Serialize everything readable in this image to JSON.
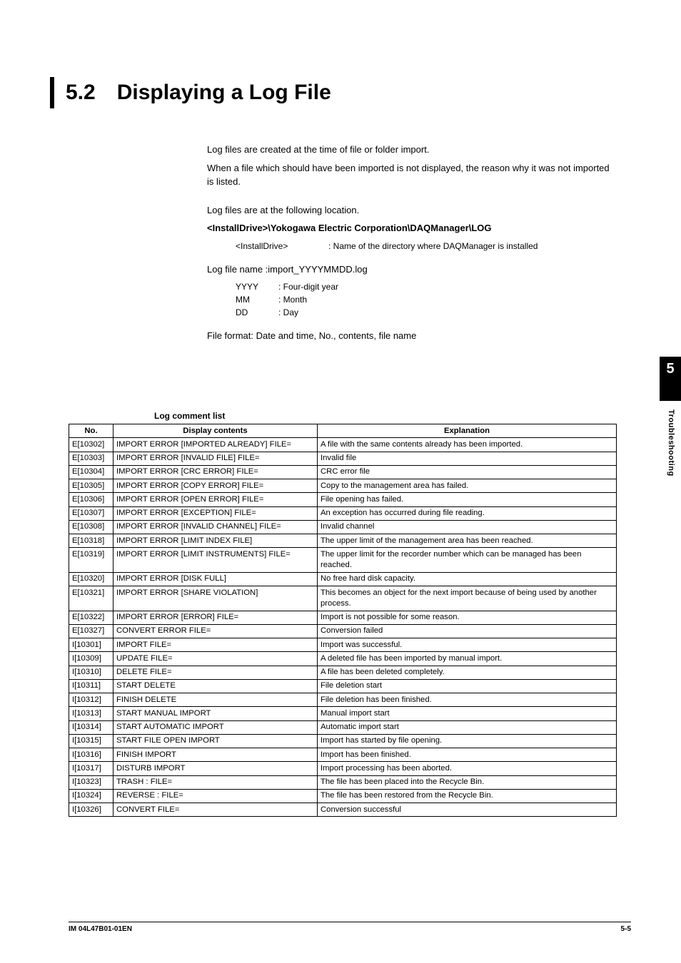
{
  "heading": {
    "number": "5.2",
    "title": "Displaying a Log File"
  },
  "intro": {
    "p1": "Log files are created at the time of file or folder import.",
    "p2": "When a file which should have been imported is not displayed, the reason why it was not imported is listed.",
    "p3": "Log files are at the following location.",
    "path": "<InstallDrive>\\Yokogawa Electric Corporation\\DAQManager\\LOG",
    "install_kv": {
      "k": "<InstallDrive>",
      "v": ": Name of the directory where DAQManager is installed"
    },
    "p4": "Log file name :import_YYYYMMDD.log",
    "kv1": {
      "k": "YYYY",
      "v": ": Four-digit year"
    },
    "kv2": {
      "k": "MM",
      "v": ": Month"
    },
    "kv3": {
      "k": "DD",
      "v": ": Day"
    },
    "p5": "File format: Date and time, No., contents, file name"
  },
  "table": {
    "caption": "Log comment list",
    "headers": {
      "no": "No.",
      "disp": "Display contents",
      "expl": "Explanation"
    },
    "rows": [
      {
        "no": "E[10302]",
        "disp": "IMPORT ERROR [IMPORTED ALREADY] FILE=",
        "expl": "A file with the same contents already has been imported."
      },
      {
        "no": "E[10303]",
        "disp": "IMPORT ERROR [INVALID FILE] FILE=",
        "expl": "Invalid file"
      },
      {
        "no": "E[10304]",
        "disp": "IMPORT ERROR [CRC ERROR] FILE=",
        "expl": "CRC error file"
      },
      {
        "no": "E[10305]",
        "disp": "IMPORT ERROR [COPY ERROR] FILE=",
        "expl": "Copy to the management area has failed."
      },
      {
        "no": "E[10306]",
        "disp": "IMPORT ERROR [OPEN ERROR] FILE=",
        "expl": "File opening has failed."
      },
      {
        "no": "E[10307]",
        "disp": "IMPORT ERROR [EXCEPTION] FILE=",
        "expl": "An exception has occurred during file reading."
      },
      {
        "no": "E[10308]",
        "disp": "IMPORT ERROR [INVALID CHANNEL] FILE=",
        "expl": "Invalid channel"
      },
      {
        "no": "E[10318]",
        "disp": "IMPORT ERROR [LIMIT INDEX FILE]",
        "expl": "The upper limit of the management area has been reached."
      },
      {
        "no": "E[10319]",
        "disp": "IMPORT ERROR [LIMIT INSTRUMENTS] FILE=",
        "expl": "The upper limit for the recorder number which can be managed has been reached."
      },
      {
        "no": "E[10320]",
        "disp": "IMPORT ERROR [DISK FULL]",
        "expl": "No free hard disk capacity."
      },
      {
        "no": "E[10321]",
        "disp": "IMPORT ERROR [SHARE VIOLATION]",
        "expl": "This becomes an object for the next import because of being used by another process."
      },
      {
        "no": "E[10322]",
        "disp": "IMPORT ERROR [ERROR] FILE=",
        "expl": "Import is not possible for some reason."
      },
      {
        "no": "E[10327]",
        "disp": "CONVERT ERROR FILE=",
        "expl": "Conversion failed"
      },
      {
        "no": "I[10301]",
        "disp": "IMPORT FILE=",
        "expl": "Import was successful."
      },
      {
        "no": "I[10309]",
        "disp": "UPDATE FILE=",
        "expl": "A deleted file has been imported by manual import."
      },
      {
        "no": "I[10310]",
        "disp": "DELETE FILE=",
        "expl": "A file has been deleted completely."
      },
      {
        "no": "I[10311]",
        "disp": "START DELETE",
        "expl": "File deletion start"
      },
      {
        "no": "I[10312]",
        "disp": "FINISH DELETE",
        "expl": "File deletion has been finished."
      },
      {
        "no": "I[10313]",
        "disp": "START MANUAL IMPORT",
        "expl": "Manual import start"
      },
      {
        "no": "I[10314]",
        "disp": "START AUTOMATIC IMPORT",
        "expl": "Automatic import start"
      },
      {
        "no": "I[10315]",
        "disp": "START FILE OPEN IMPORT",
        "expl": "Import has started by file opening."
      },
      {
        "no": "I[10316]",
        "disp": "FINISH IMPORT",
        "expl": "Import has been finished."
      },
      {
        "no": "I[10317]",
        "disp": "DISTURB IMPORT",
        "expl": "Import processing has been aborted."
      },
      {
        "no": "I[10323]",
        "disp": "TRASH : FILE=",
        "expl": "The file has been placed into the Recycle Bin."
      },
      {
        "no": "I[10324]",
        "disp": "REVERSE : FILE=",
        "expl": "The file has been restored from the Recycle Bin."
      },
      {
        "no": "I[10326]",
        "disp": "CONVERT FILE=",
        "expl": "Conversion successful"
      }
    ]
  },
  "side_tab": {
    "number": "5",
    "label": "Troubleshooting"
  },
  "footer": {
    "left": "IM 04L47B01-01EN",
    "right": "5-5"
  }
}
